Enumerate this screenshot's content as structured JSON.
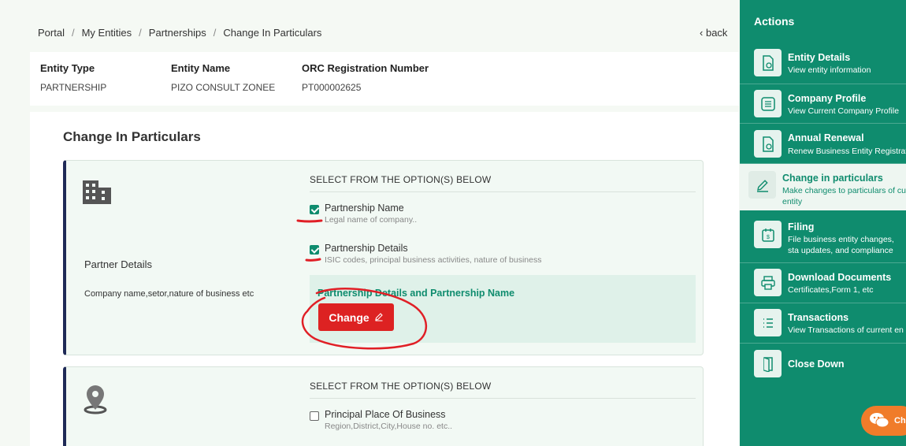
{
  "breadcrumb": [
    "Portal",
    "My Entities",
    "Partnerships",
    "Change In Particulars"
  ],
  "back_label": "back",
  "entity": {
    "type_label": "Entity Type",
    "type_value": "PARTNERSHIP",
    "name_label": "Entity Name",
    "name_value": "PIZO CONSULT ZONEE",
    "orc_label": "ORC Registration Number",
    "orc_value": "PT000002625"
  },
  "page_title": "Change In Particulars",
  "panel1": {
    "icon": "building-icon",
    "title": "Partner Details",
    "subtitle": "Company name,setor,nature of business etc",
    "options_heading": "SELECT FROM THE OPTION(S) BELOW",
    "options": [
      {
        "title": "Partnership Name",
        "sub": "Legal name of company..",
        "checked": true
      },
      {
        "title": "Partnership Details",
        "sub": "ISIC codes, principal business activities, nature of business",
        "checked": true
      }
    ],
    "change_title": "Partnership Details and Partnership Name",
    "change_button": "Change"
  },
  "panel2": {
    "icon": "location-pin-icon",
    "options_heading": "SELECT FROM THE OPTION(S) BELOW",
    "options": [
      {
        "title": "Principal Place Of Business",
        "sub": "Region,District,City,House no. etc..",
        "checked": false
      }
    ]
  },
  "sidebar": {
    "title": "Actions",
    "items": [
      {
        "title": "Entity Details",
        "sub": "View entity information",
        "icon": "document-view-icon"
      },
      {
        "title": "Company Profile",
        "sub": "View Current Company Profile",
        "icon": "list-document-icon"
      },
      {
        "title": "Annual Renewal",
        "sub": "Renew Business Entity Registrat",
        "icon": "document-renew-icon"
      },
      {
        "title": "Change in particulars",
        "sub": "Make changes to particulars of cu entity",
        "icon": "edit-pencil-icon"
      },
      {
        "title": "Filing",
        "sub": "File business entity changes, sta updates, and compliance docu",
        "icon": "filing-icon"
      },
      {
        "title": "Download Documents",
        "sub": "Certificates,Form 1, etc",
        "icon": "printer-icon"
      },
      {
        "title": "Transactions",
        "sub": "View Transactions of current en",
        "icon": "transactions-list-icon"
      },
      {
        "title": "Close Down",
        "sub": "",
        "icon": "door-exit-icon"
      }
    ]
  },
  "chat_label": "Ch",
  "colors": {
    "accent": "#0f8c6e",
    "danger": "#dd2222",
    "navy": "#1f2a57",
    "annotation": "#e01f26"
  }
}
